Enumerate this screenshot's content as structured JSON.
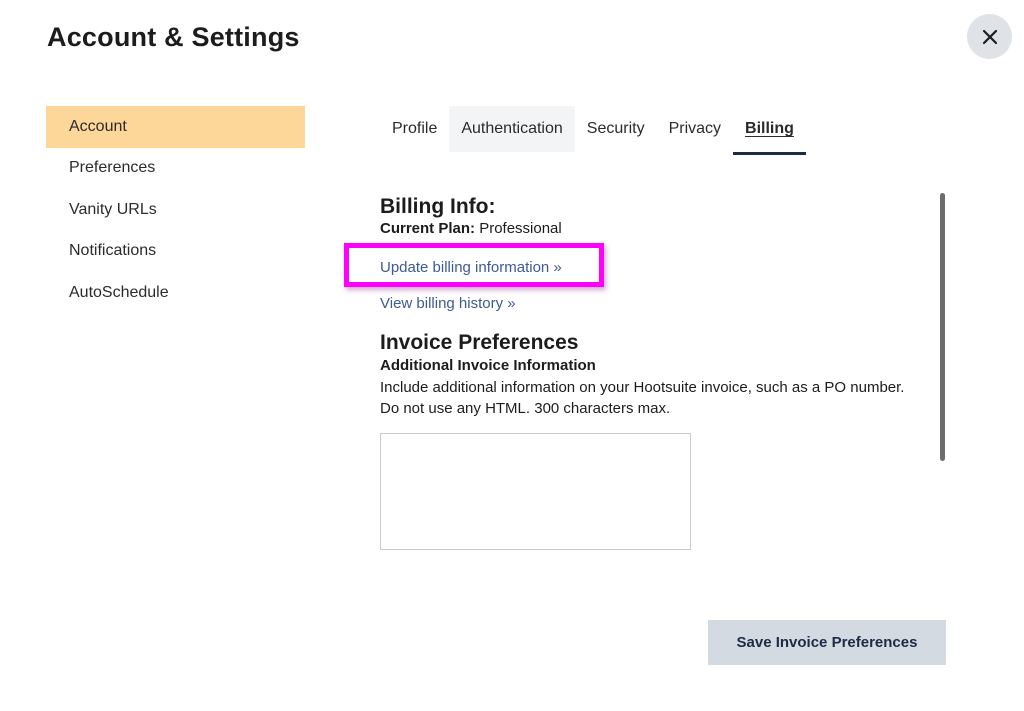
{
  "header": {
    "title": "Account & Settings",
    "close_icon": "close-icon"
  },
  "sidebar": {
    "items": [
      {
        "label": "Account",
        "active": true
      },
      {
        "label": "Preferences",
        "active": false
      },
      {
        "label": "Vanity URLs",
        "active": false
      },
      {
        "label": "Notifications",
        "active": false
      },
      {
        "label": "AutoSchedule",
        "active": false
      }
    ]
  },
  "tabs": [
    {
      "label": "Profile"
    },
    {
      "label": "Authentication"
    },
    {
      "label": "Security"
    },
    {
      "label": "Privacy"
    },
    {
      "label": "Billing",
      "active": true
    }
  ],
  "billing": {
    "heading": "Billing Info:",
    "plan_label": "Current Plan:",
    "plan_value": "Professional",
    "update_link": "Update billing information »",
    "history_link": "View billing history »"
  },
  "invoice": {
    "heading": "Invoice Preferences",
    "subheading": "Additional Invoice Information",
    "help_line1": "Include additional information on your Hootsuite invoice, such as a PO number.",
    "help_line2": "Do not use any HTML. 300 characters max.",
    "textarea_value": ""
  },
  "actions": {
    "save_label": "Save Invoice Preferences"
  },
  "colors": {
    "active_sidebar": "#fdd699",
    "highlight_box": "#ff00ff",
    "link": "#3d5a95",
    "save_button_bg": "#d4dae1"
  }
}
